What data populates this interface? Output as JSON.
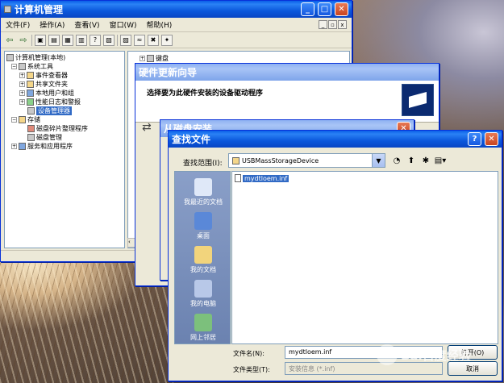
{
  "computer_management": {
    "title": "计算机管理",
    "menu": [
      "文件(F)",
      "操作(A)",
      "查看(V)",
      "窗口(W)",
      "帮助(H)"
    ],
    "tree": [
      {
        "label": "计算机管理(本地)",
        "level": 0
      },
      {
        "label": "系统工具",
        "level": 1
      },
      {
        "label": "事件查看器",
        "level": 2
      },
      {
        "label": "共享文件夹",
        "level": 2
      },
      {
        "label": "本地用户和组",
        "level": 2
      },
      {
        "label": "性能日志和警报",
        "level": 2
      },
      {
        "label": "设备管理器",
        "level": 2,
        "selected": true
      },
      {
        "label": "存储",
        "level": 1
      },
      {
        "label": "磁盘碎片整理程序",
        "level": 2
      },
      {
        "label": "磁盘管理",
        "level": 2
      },
      {
        "label": "服务和应用程序",
        "level": 1
      }
    ],
    "right_item": "键盘"
  },
  "hardware_wizard": {
    "title": "硬件更新向导",
    "heading": "选择要为此硬件安装的设备驱动程序"
  },
  "find_disk": {
    "title": "从磁盘安装"
  },
  "find_file": {
    "title": "查找文件",
    "look_in_label": "查找范围(I):",
    "look_in_value": "USBMassStorageDevice",
    "places": [
      "我最近的文档",
      "桌面",
      "我的文档",
      "我的电脑",
      "网上邻居"
    ],
    "files": [
      "mydtloem.inf"
    ],
    "filename_label": "文件名(N):",
    "filename_value": "mydtloem.inf",
    "filetype_label": "文件类型(T):",
    "filetype_value": "安装信息 (*.inf)",
    "open_button": "打开(O)",
    "cancel_button": "取消"
  },
  "watermark": "Bai百度经验"
}
